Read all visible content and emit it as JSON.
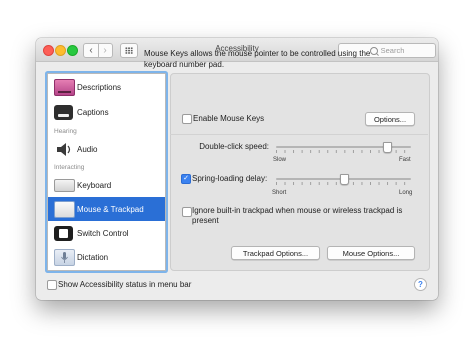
{
  "window": {
    "title": "Accessibility",
    "search_placeholder": "Search"
  },
  "sidebar": {
    "items": [
      {
        "label": "Descriptions",
        "icon": "descriptions-icon"
      },
      {
        "label": "Captions",
        "icon": "captions-icon"
      },
      {
        "label": "Audio",
        "icon": "speaker-icon"
      },
      {
        "label": "Keyboard",
        "icon": "keyboard-icon"
      },
      {
        "label": "Mouse & Trackpad",
        "icon": "trackpad-icon",
        "selected": true
      },
      {
        "label": "Switch Control",
        "icon": "switch-control-icon"
      },
      {
        "label": "Dictation",
        "icon": "microphone-icon"
      }
    ],
    "sections": {
      "hearing": "Hearing",
      "interacting": "Interacting"
    }
  },
  "main": {
    "description": "Mouse Keys allows the mouse pointer to be controlled using the keyboard number pad.",
    "enable_mouse_keys": {
      "label": "Enable Mouse Keys",
      "checked": false
    },
    "options_button": "Options...",
    "double_click": {
      "label": "Double-click speed:",
      "min_label": "Slow",
      "max_label": "Fast",
      "value": 0.82
    },
    "spring_loading": {
      "label": "Spring-loading delay:",
      "checked": true,
      "min_label": "Short",
      "max_label": "Long",
      "value": 0.5
    },
    "ignore_trackpad": {
      "label": "Ignore built-in trackpad when mouse or wireless trackpad is present",
      "checked": false
    },
    "trackpad_options_button": "Trackpad Options...",
    "mouse_options_button": "Mouse Options..."
  },
  "footer": {
    "show_status": {
      "label": "Show Accessibility status in menu bar",
      "checked": false
    },
    "help": "?"
  },
  "colors": {
    "selection": "#2a6fd6",
    "checkbox_on": "#3b82f0"
  }
}
